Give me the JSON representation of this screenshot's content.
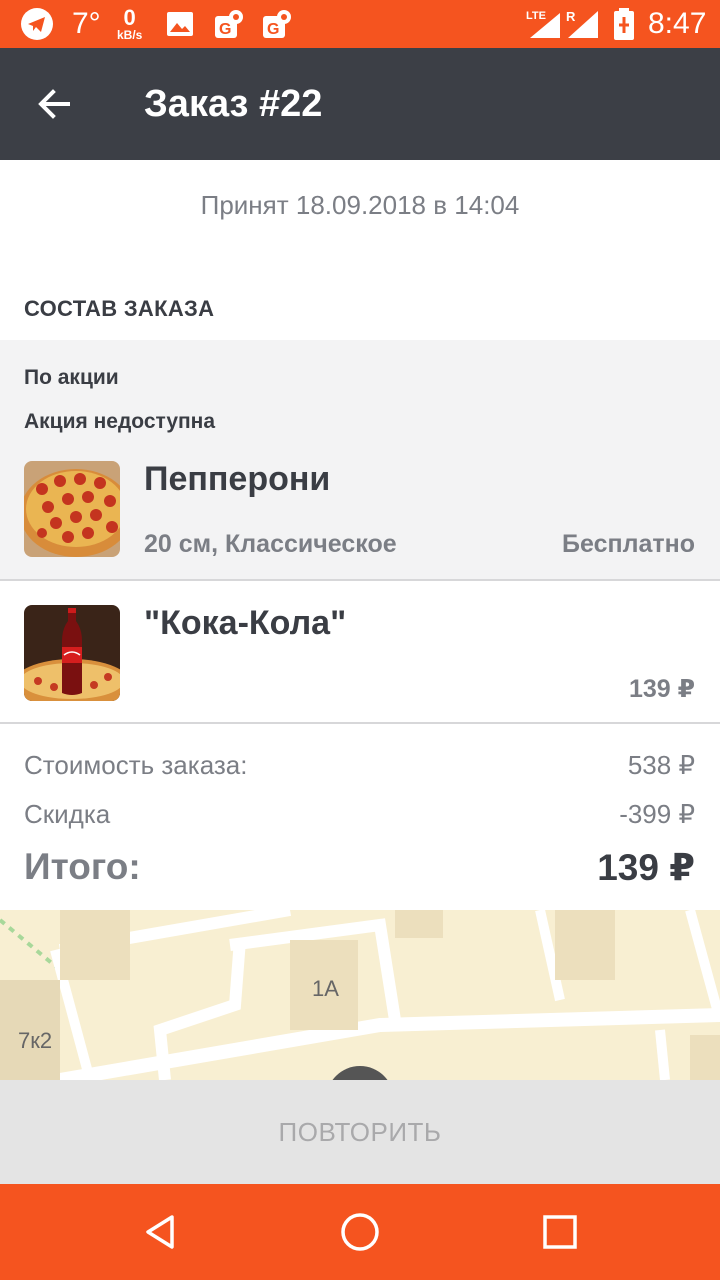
{
  "status_bar": {
    "temperature": "7°",
    "net_speed_value": "0",
    "net_speed_unit": "kB/s",
    "network_label": "LTE",
    "roaming_label": "R",
    "time": "8:47",
    "icons": [
      "telegram-icon",
      "gallery-icon",
      "maps-icon",
      "maps-icon",
      "signal-icon",
      "battery-icon"
    ]
  },
  "header": {
    "title": "Заказ #22"
  },
  "order": {
    "accepted_text": "Принят 18.09.2018 в 14:04",
    "section_title": "СОСТАВ ЗАКАЗА",
    "promo": {
      "label": "По акции",
      "status": "Акция недоступна"
    },
    "items": [
      {
        "name": "Пепперони",
        "description": "20 см, Классическое",
        "price": "Бесплатно"
      },
      {
        "name": "\"Кока-Кола\"",
        "description": "",
        "price": "139 ₽"
      }
    ]
  },
  "summary": {
    "cost_label": "Стоимость заказа:",
    "cost_value": "538 ₽",
    "discount_label": "Скидка",
    "discount_value": "-399 ₽",
    "total_label": "Итого:",
    "total_value": "139 ₽"
  },
  "map": {
    "labels": [
      "1А",
      "7к2"
    ]
  },
  "actions": {
    "repeat_label": "ПОВТОРИТЬ"
  },
  "colors": {
    "accent": "#f5541f",
    "app_bar": "#3c3f46",
    "promo_bg": "#f3f3f4",
    "map_bg": "#f8efd2"
  }
}
